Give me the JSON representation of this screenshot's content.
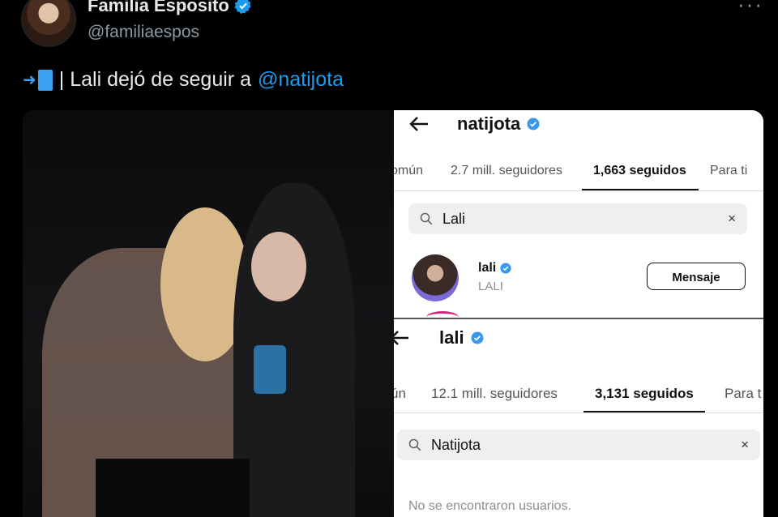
{
  "tweet": {
    "display_name": "Familia Esposito",
    "handle": "@familiaespos",
    "more_label": "···",
    "text_prefix": "| Lali dejó de seguir a",
    "mention": "@natijota"
  },
  "screenshot_top": {
    "username": "natijota",
    "tabs": {
      "common": "omún",
      "followers": "2.7 mill. seguidores",
      "following": "1,663 seguidos",
      "for_you": "Para ti"
    },
    "search_value": "Lali",
    "clear_icon": "×",
    "result": {
      "username": "lali",
      "fullname": "LALI",
      "button": "Mensaje"
    }
  },
  "screenshot_bottom": {
    "username": "lali",
    "tabs": {
      "common": "ún",
      "followers": "12.1 mill. seguidores",
      "following": "3,131 seguidos",
      "for_you": "Para t"
    },
    "search_value": "Natijota",
    "clear_icon": "×",
    "empty_message": "No se encontraron usuarios."
  },
  "colors": {
    "background": "#000000",
    "mention": "#1d9bf0",
    "verified": "#1d9bf0",
    "ig_background": "#ffffff"
  },
  "icons": [
    "verified-badge-icon",
    "more-icon",
    "exit-emoji-icon",
    "back-arrow-icon",
    "search-icon",
    "close-icon"
  ]
}
